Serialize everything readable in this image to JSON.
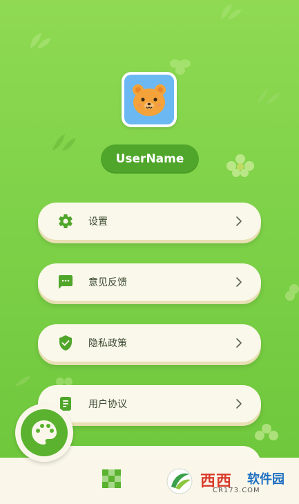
{
  "profile": {
    "username": "UserName",
    "avatar_icon": "bear-avatar-icon"
  },
  "menu": [
    {
      "label": "设置",
      "icon": "gear-icon"
    },
    {
      "label": "意见反馈",
      "icon": "feedback-icon"
    },
    {
      "label": "隐私政策",
      "icon": "shield-check-icon"
    },
    {
      "label": "用户协议",
      "icon": "document-icon"
    }
  ],
  "bottom_nav": {
    "tabs": [
      {
        "icon": "palette-icon",
        "active": true
      },
      {
        "icon": "pixel-grid-icon",
        "active": false
      }
    ]
  },
  "watermark": {
    "brand": "西西",
    "brand2": "软件园",
    "sub": "CR173.COM"
  },
  "colors": {
    "background": "#7dd148",
    "accent_green": "#5ab22f",
    "card": "#faf8ea",
    "avatar_bg": "#6cb8f2"
  }
}
